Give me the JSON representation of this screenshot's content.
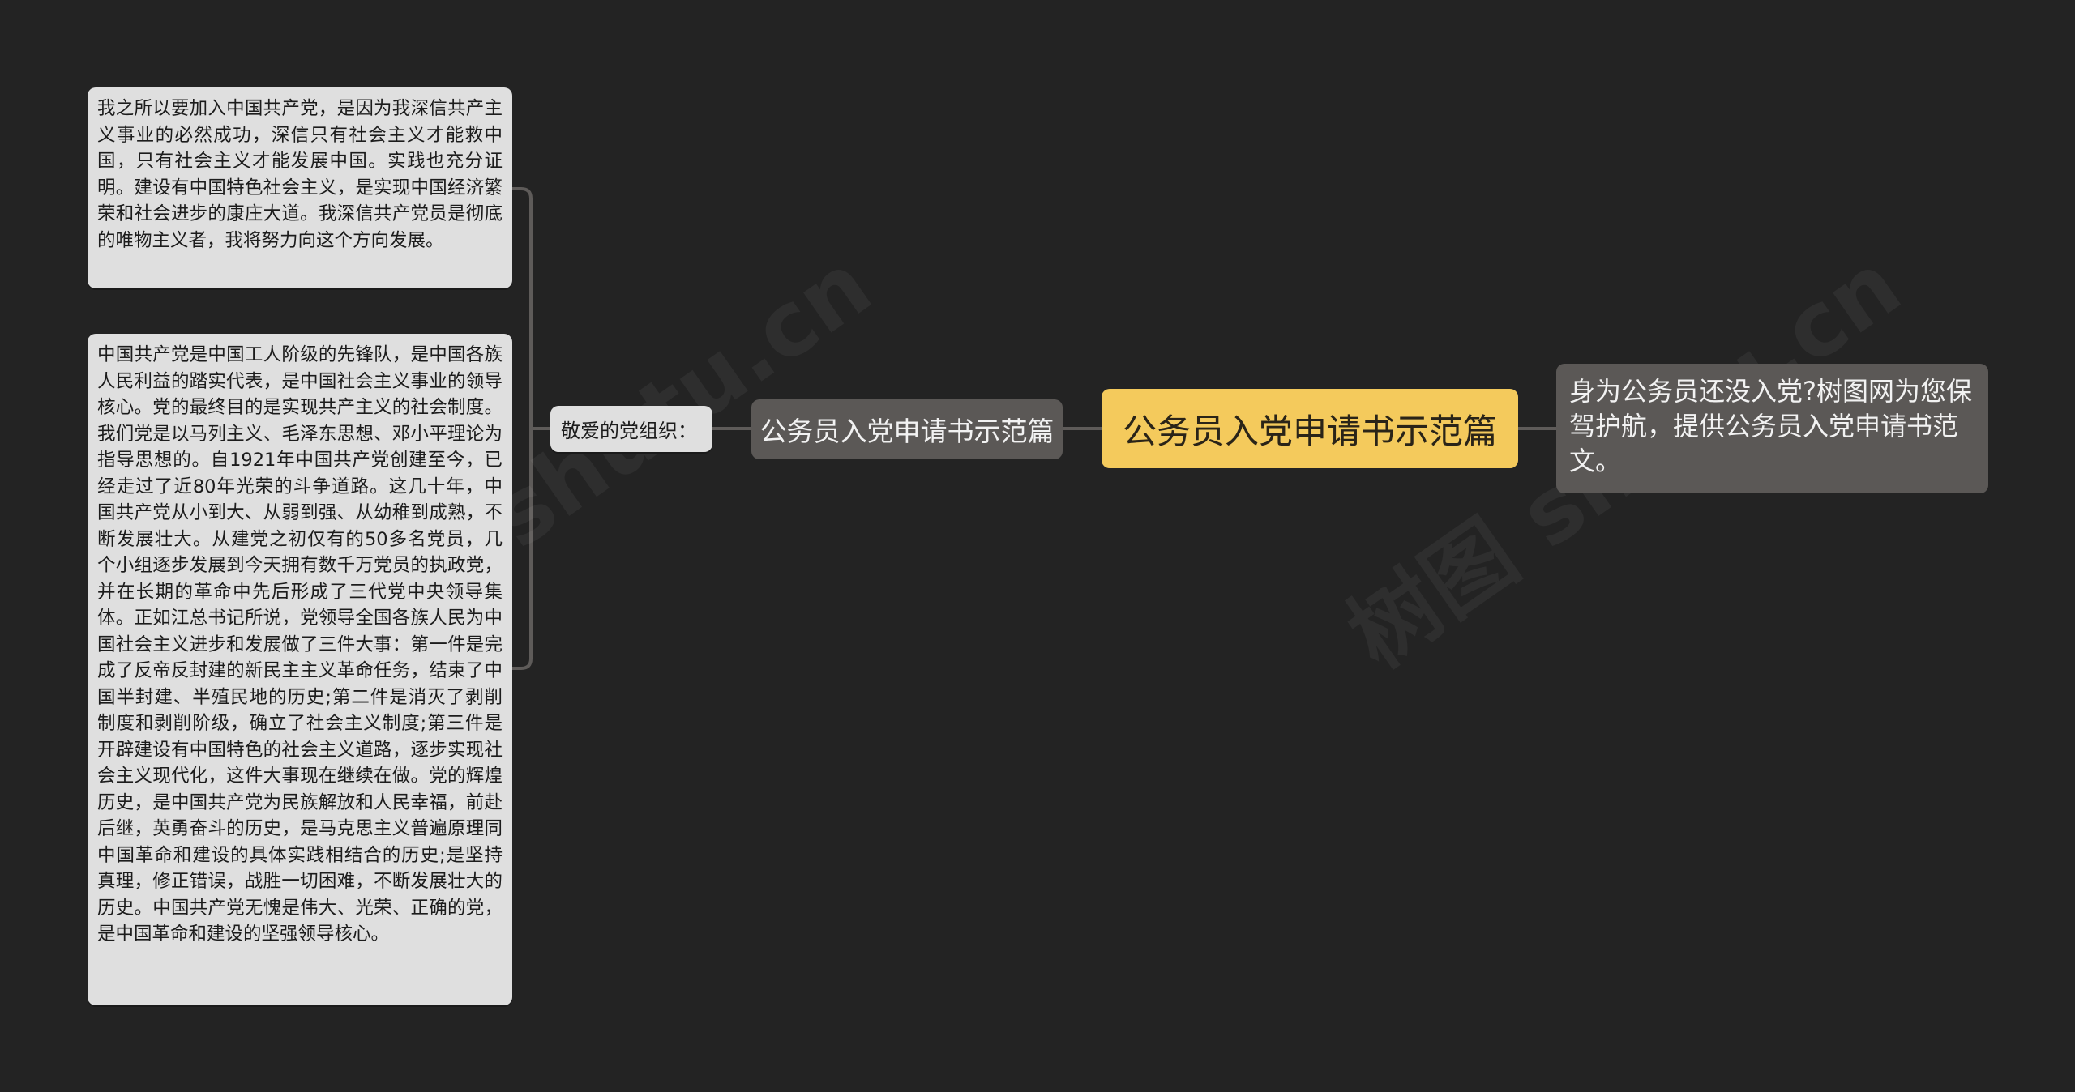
{
  "mindmap": {
    "root": {
      "label": "公务员入党申请书示范篇"
    },
    "description": {
      "text": "身为公务员还没入党?树图网为您保驾护航，提供公务员入党申请书范文。"
    },
    "branch": {
      "label": "公务员入党申请书示范篇"
    },
    "sub_branch": {
      "label": "敬爱的党组织："
    },
    "leaves": [
      {
        "text": "我之所以要加入中国共产党，是因为我深信共产主义事业的必然成功，深信只有社会主义才能救中国，只有社会主义才能发展中国。实践也充分证明。建设有中国特色社会主义，是实现中国经济繁荣和社会进步的康庄大道。我深信共产党员是彻底的唯物主义者，我将努力向这个方向发展。"
      },
      {
        "text": "中国共产党是中国工人阶级的先锋队，是中国各族人民利益的踏实代表，是中国社会主义事业的领导核心。党的最终目的是实现共产主义的社会制度。我们党是以马列主义、毛泽东思想、邓小平理论为指导思想的。自1921年中国共产党创建至今，已经走过了近80年光荣的斗争道路。这几十年，中国共产党从小到大、从弱到强、从幼稚到成熟，不断发展壮大。从建党之初仅有的50多名党员，几个小组逐步发展到今天拥有数千万党员的执政党，并在长期的革命中先后形成了三代党中央领导集体。正如江总书记所说，党领导全国各族人民为中国社会主义进步和发展做了三件大事：第一件是完成了反帝反封建的新民主主义革命任务，结束了中国半封建、半殖民地的历史;第二件是消灭了剥削制度和剥削阶级，确立了社会主义制度;第三件是开辟建设有中国特色的社会主义道路，逐步实现社会主义现代化，这件大事现在继续在做。党的辉煌历史，是中国共产党为民族解放和人民幸福，前赴后继，英勇奋斗的历史，是马克思主义普遍原理同中国革命和建设的具体实践相结合的历史;是坚持真理，修正错误，战胜一切困难，不断发展壮大的历史。中国共产党无愧是伟大、光荣、正确的党，是中国革命和建设的坚强领导核心。"
      }
    ]
  },
  "watermarks": [
    "树图 shutu.cn",
    "树图 shutu.cn"
  ],
  "colors": {
    "background": "#232323",
    "root": "#f4ca5c",
    "branch": "#5b5856",
    "leaf": "#dfdfdf",
    "connector": "#5e5b59"
  }
}
